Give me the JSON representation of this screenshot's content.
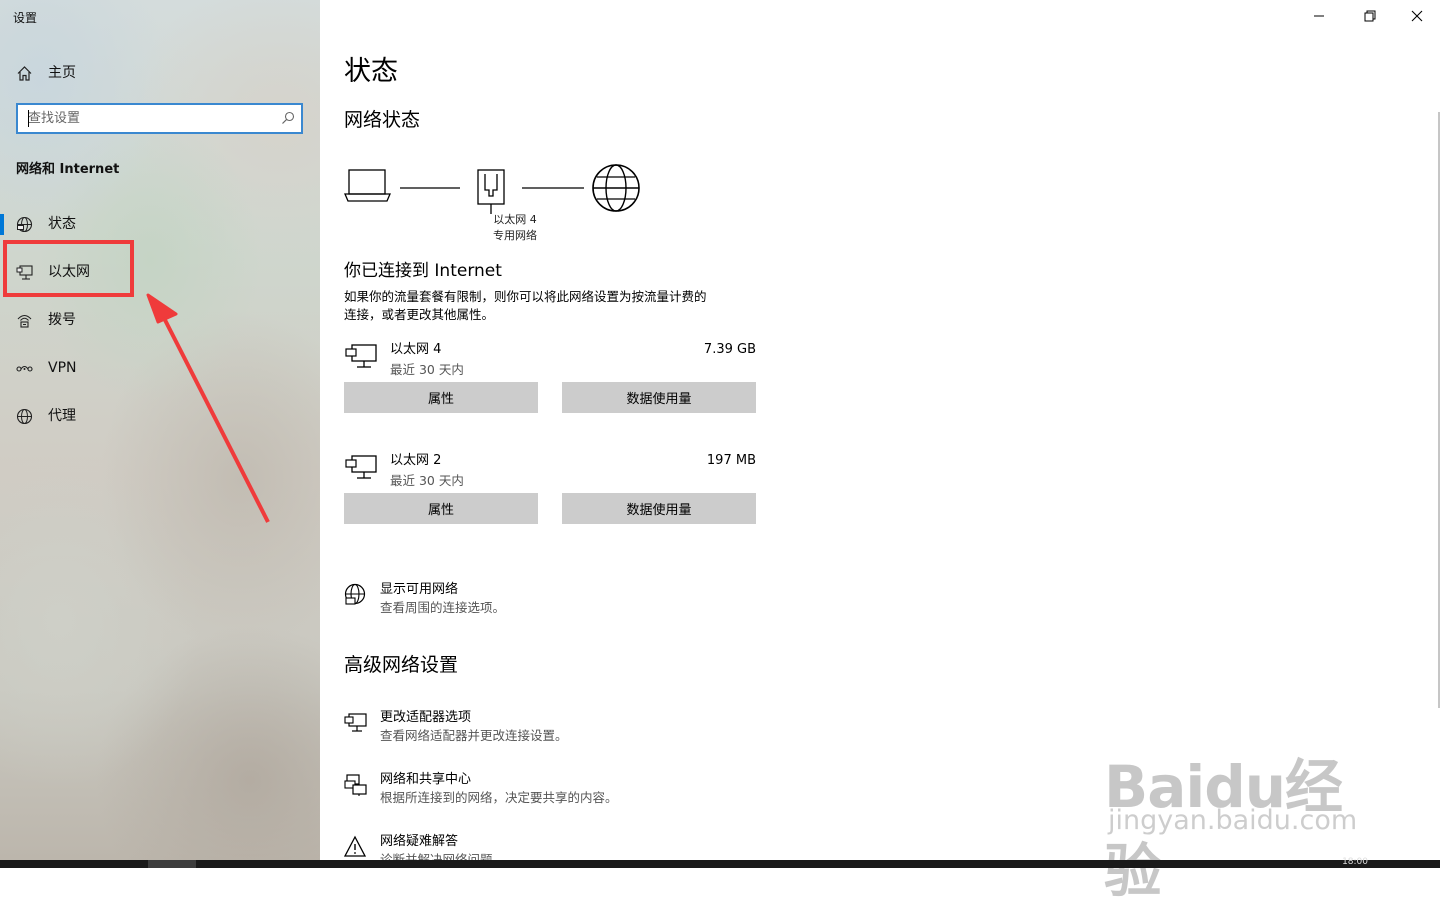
{
  "window": {
    "title": "设置",
    "controls": {
      "minimize": "minimize-icon",
      "restore": "restore-icon",
      "close": "close-icon"
    }
  },
  "sidebar": {
    "home_label": "主页",
    "search": {
      "placeholder": "查找设置",
      "value": ""
    },
    "section_title": "网络和 Internet",
    "items": [
      {
        "label": "状态",
        "icon": "status-globe-icon",
        "active": true
      },
      {
        "label": "以太网",
        "icon": "ethernet-icon",
        "active": false
      },
      {
        "label": "拨号",
        "icon": "dialup-icon",
        "active": false
      },
      {
        "label": "VPN",
        "icon": "vpn-icon",
        "active": false
      },
      {
        "label": "代理",
        "icon": "proxy-globe-icon",
        "active": false
      }
    ],
    "accent_color": "#0078d7"
  },
  "main": {
    "page_title": "状态",
    "network_status_heading": "网络状态",
    "diagram": {
      "adapter_name": "以太网 4",
      "network_type": "专用网络"
    },
    "connected_heading": "你已连接到 Internet",
    "metered_text_line1": "如果你的流量套餐有限制，则你可以将此网络设置为按流量计费的",
    "metered_text_line2": "连接，或者更改其他属性。",
    "adapters": [
      {
        "name": "以太网 4",
        "period": "最近 30 天内",
        "usage": "7.39 GB",
        "properties_button": "属性",
        "data_usage_button": "数据使用量"
      },
      {
        "name": "以太网 2",
        "period": "最近 30 天内",
        "usage": "197 MB",
        "properties_button": "属性",
        "data_usage_button": "数据使用量"
      }
    ],
    "show_networks": {
      "title": "显示可用网络",
      "subtitle": "查看周围的连接选项。"
    },
    "advanced_heading": "高级网络设置",
    "advanced_items": [
      {
        "title": "更改适配器选项",
        "subtitle": "查看网络适配器并更改连接设置。",
        "icon": "adapter-options-icon"
      },
      {
        "title": "网络和共享中心",
        "subtitle": "根据所连接到的网络，决定要共享的内容。",
        "icon": "sharing-center-icon"
      },
      {
        "title": "网络疑难解答",
        "subtitle": "诊断并解决网络问题。",
        "icon": "troubleshoot-warning-icon"
      }
    ]
  },
  "annotation": {
    "highlight_color": "#ef3b3b"
  },
  "taskbar": {
    "clock": "18:00"
  },
  "watermark": {
    "brand": "Baidu经验",
    "url": "jingyan.baidu.com"
  }
}
